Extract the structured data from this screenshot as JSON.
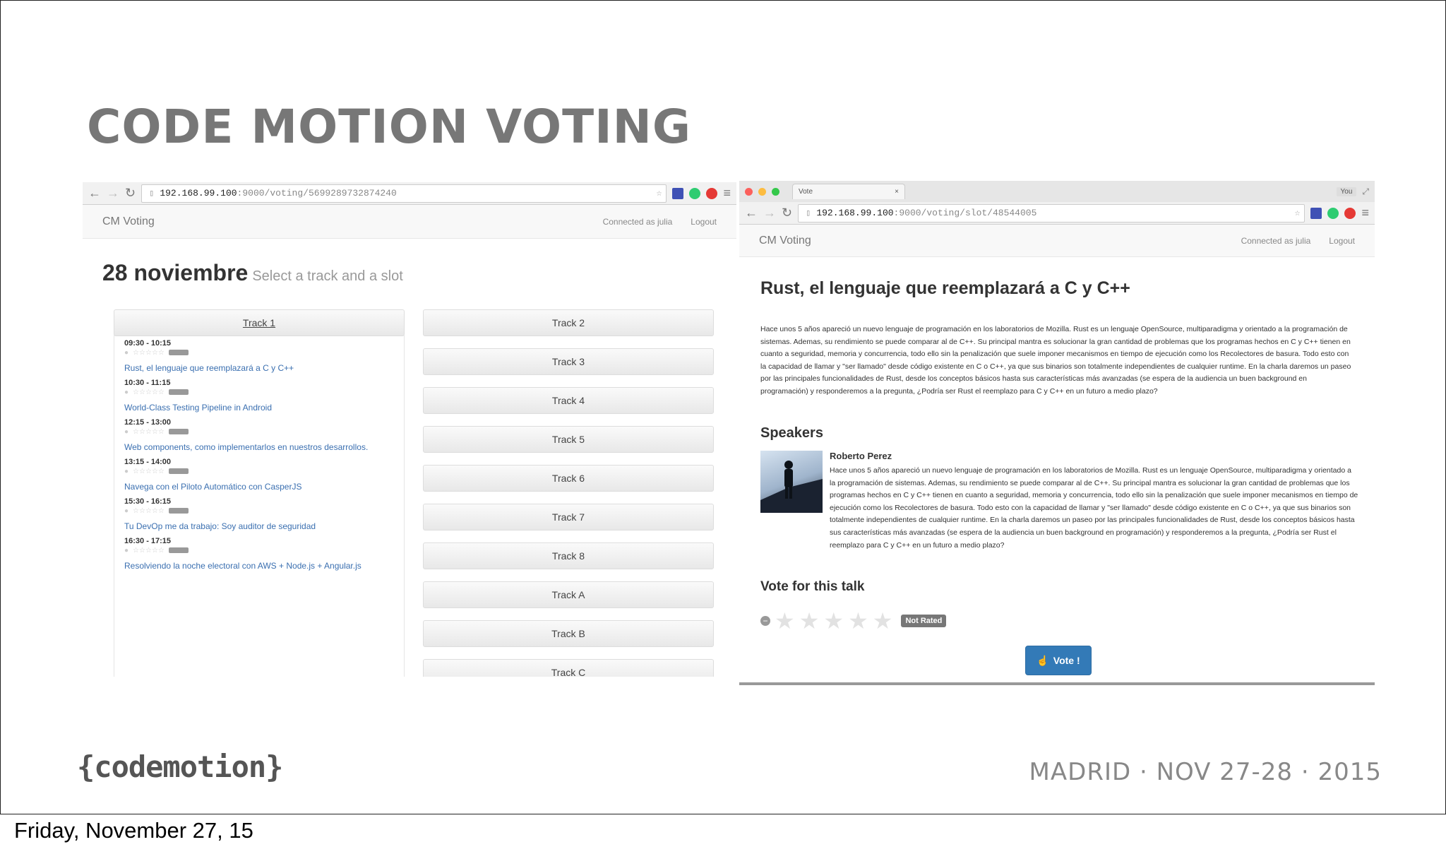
{
  "slide": {
    "title": "CODE MOTION VOTING",
    "logo_text": "{codemotion}",
    "footer_info": "MADRID · NOV 27-28 · 2015"
  },
  "date_caption": "Friday, November 27, 15",
  "left_window": {
    "url_host": "192.168.99.100",
    "url_path": ":9000/voting/5699289732874240",
    "app": {
      "brand": "CM Voting",
      "connected": "Connected as julia",
      "logout": "Logout"
    },
    "day": "28 noviembre",
    "hint": "Select a track and a slot",
    "tracks": [
      "Track 1",
      "Track 2",
      "Track 3",
      "Track 4",
      "Track 5",
      "Track 6",
      "Track 7",
      "Track 8",
      "Track A",
      "Track B",
      "Track C"
    ],
    "slots": [
      {
        "time": "09:30 - 10:15",
        "talk": "Rust, el lenguaje que reemplazará a C y C++"
      },
      {
        "time": "10:30 - 11:15",
        "talk": "World-Class Testing Pipeline in Android"
      },
      {
        "time": "12:15 - 13:00",
        "talk": "Web components, como implementarlos en nuestros desarrollos."
      },
      {
        "time": "13:15 - 14:00",
        "talk": "Navega con el Piloto Automático con CasperJS"
      },
      {
        "time": "15:30 - 16:15",
        "talk": "Tu DevOp me da trabajo: Soy auditor de seguridad"
      },
      {
        "time": "16:30 - 17:15",
        "talk": "Resolviendo la noche electoral con AWS + Node.js + Angular.js"
      }
    ]
  },
  "right_window": {
    "tab_label": "Vote",
    "profile": "You",
    "url_host": "192.168.99.100",
    "url_path": ":9000/voting/slot/48544005",
    "app": {
      "brand": "CM Voting",
      "connected": "Connected as julia",
      "logout": "Logout"
    },
    "talk_title": "Rust, el lenguaje que reemplazará a C y C++",
    "description": "Hace unos 5 años apareció un nuevo lenguaje de programación en los laboratorios de Mozilla. Rust es un lenguaje OpenSource, multiparadigma y orientado a la programación de sistemas. Ademas, su rendimiento se puede comparar al de C++. Su principal mantra es solucionar la gran cantidad de problemas que los programas hechos en C y C++ tienen en cuanto a seguridad, memoria y concurrencia, todo ello sin la penalización que suele imponer mecanismos en tiempo de ejecución como los Recolectores de basura. Todo esto con la capacidad de llamar y \"ser llamado\" desde código existente en C o C++, ya que sus binarios son totalmente independientes de cualquier runtime. En la charla daremos un paseo por las principales funcionalidades de Rust, desde los conceptos básicos hasta sus características más avanzadas (se espera de la audiencia un buen background en programación) y responderemos a la pregunta, ¿Podría ser Rust el reemplazo para C y C++ en un futuro a medio plazo?",
    "speakers_heading": "Speakers",
    "speaker_name": "Roberto Perez",
    "speaker_bio": "Hace unos 5 años apareció un nuevo lenguaje de programación en los laboratorios de Mozilla. Rust es un lenguaje OpenSource, multiparadigma y orientado a la programación de sistemas. Ademas, su rendimiento se puede comparar al de C++. Su principal mantra es solucionar la gran cantidad de problemas que los programas hechos en C y C++ tienen en cuanto a seguridad, memoria y concurrencia, todo ello sin la penalización que suele imponer mecanismos en tiempo de ejecución como los Recolectores de basura. Todo esto con la capacidad de llamar y \"ser llamado\" desde código existente en C o C++, ya que sus binarios son totalmente independientes de cualquier runtime. En la charla daremos un paseo por las principales funcionalidades de Rust, desde los conceptos básicos hasta sus características más avanzadas (se espera de la audiencia un buen background en programación) y responderemos a la pregunta, ¿Podría ser Rust el reemplazo para C y C++ en un futuro a medio plazo?",
    "vote_heading": "Vote for this talk",
    "rating_badge": "Not Rated",
    "vote_button": "Vote !"
  },
  "colors": {
    "accent": "#337ab7",
    "link": "#3a6fb0",
    "title_gray": "#777777"
  }
}
